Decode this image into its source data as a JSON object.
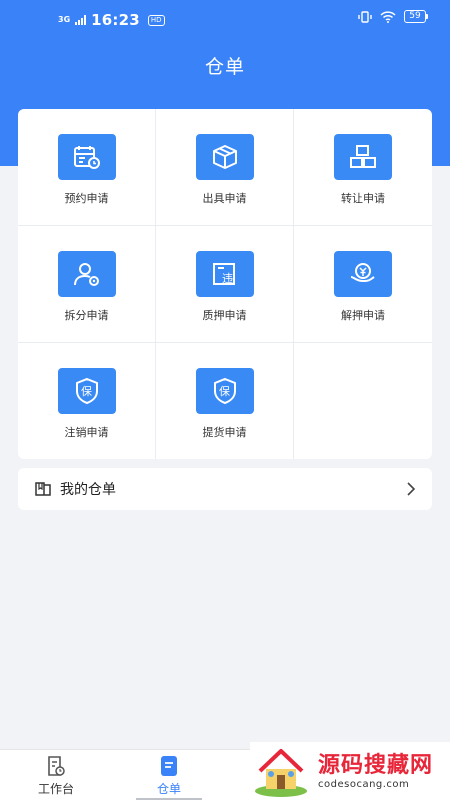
{
  "status_bar": {
    "network": "3G",
    "time": "16:23",
    "hd": "HD",
    "battery": "59"
  },
  "header": {
    "title": "仓单"
  },
  "grid": {
    "items": [
      {
        "label": "预约申请",
        "icon": "calendar-clock-icon"
      },
      {
        "label": "出具申请",
        "icon": "box-icon"
      },
      {
        "label": "转让申请",
        "icon": "stacked-boxes-icon"
      },
      {
        "label": "拆分申请",
        "icon": "user-settings-icon"
      },
      {
        "label": "质押申请",
        "icon": "pledge-doc-icon"
      },
      {
        "label": "解押申请",
        "icon": "yen-hand-icon"
      },
      {
        "label": "注销申请",
        "icon": "shield-bao-icon"
      },
      {
        "label": "提货申请",
        "icon": "shield-bao-icon"
      }
    ]
  },
  "my_warrants": {
    "label": "我的仓单",
    "icon": "book-icon"
  },
  "tabbar": {
    "tabs": [
      {
        "label": "工作台",
        "icon": "doc-clock-icon",
        "active": false
      },
      {
        "label": "仓单",
        "icon": "doc-list-icon",
        "active": true
      }
    ],
    "active_color": "#3a82f7"
  },
  "watermark": {
    "title": "源码搜藏网",
    "subtitle": "codesocang.com"
  },
  "colors": {
    "primary": "#3a82f7",
    "icon_bg": "#3a8af5",
    "background": "#f1f3f6"
  }
}
